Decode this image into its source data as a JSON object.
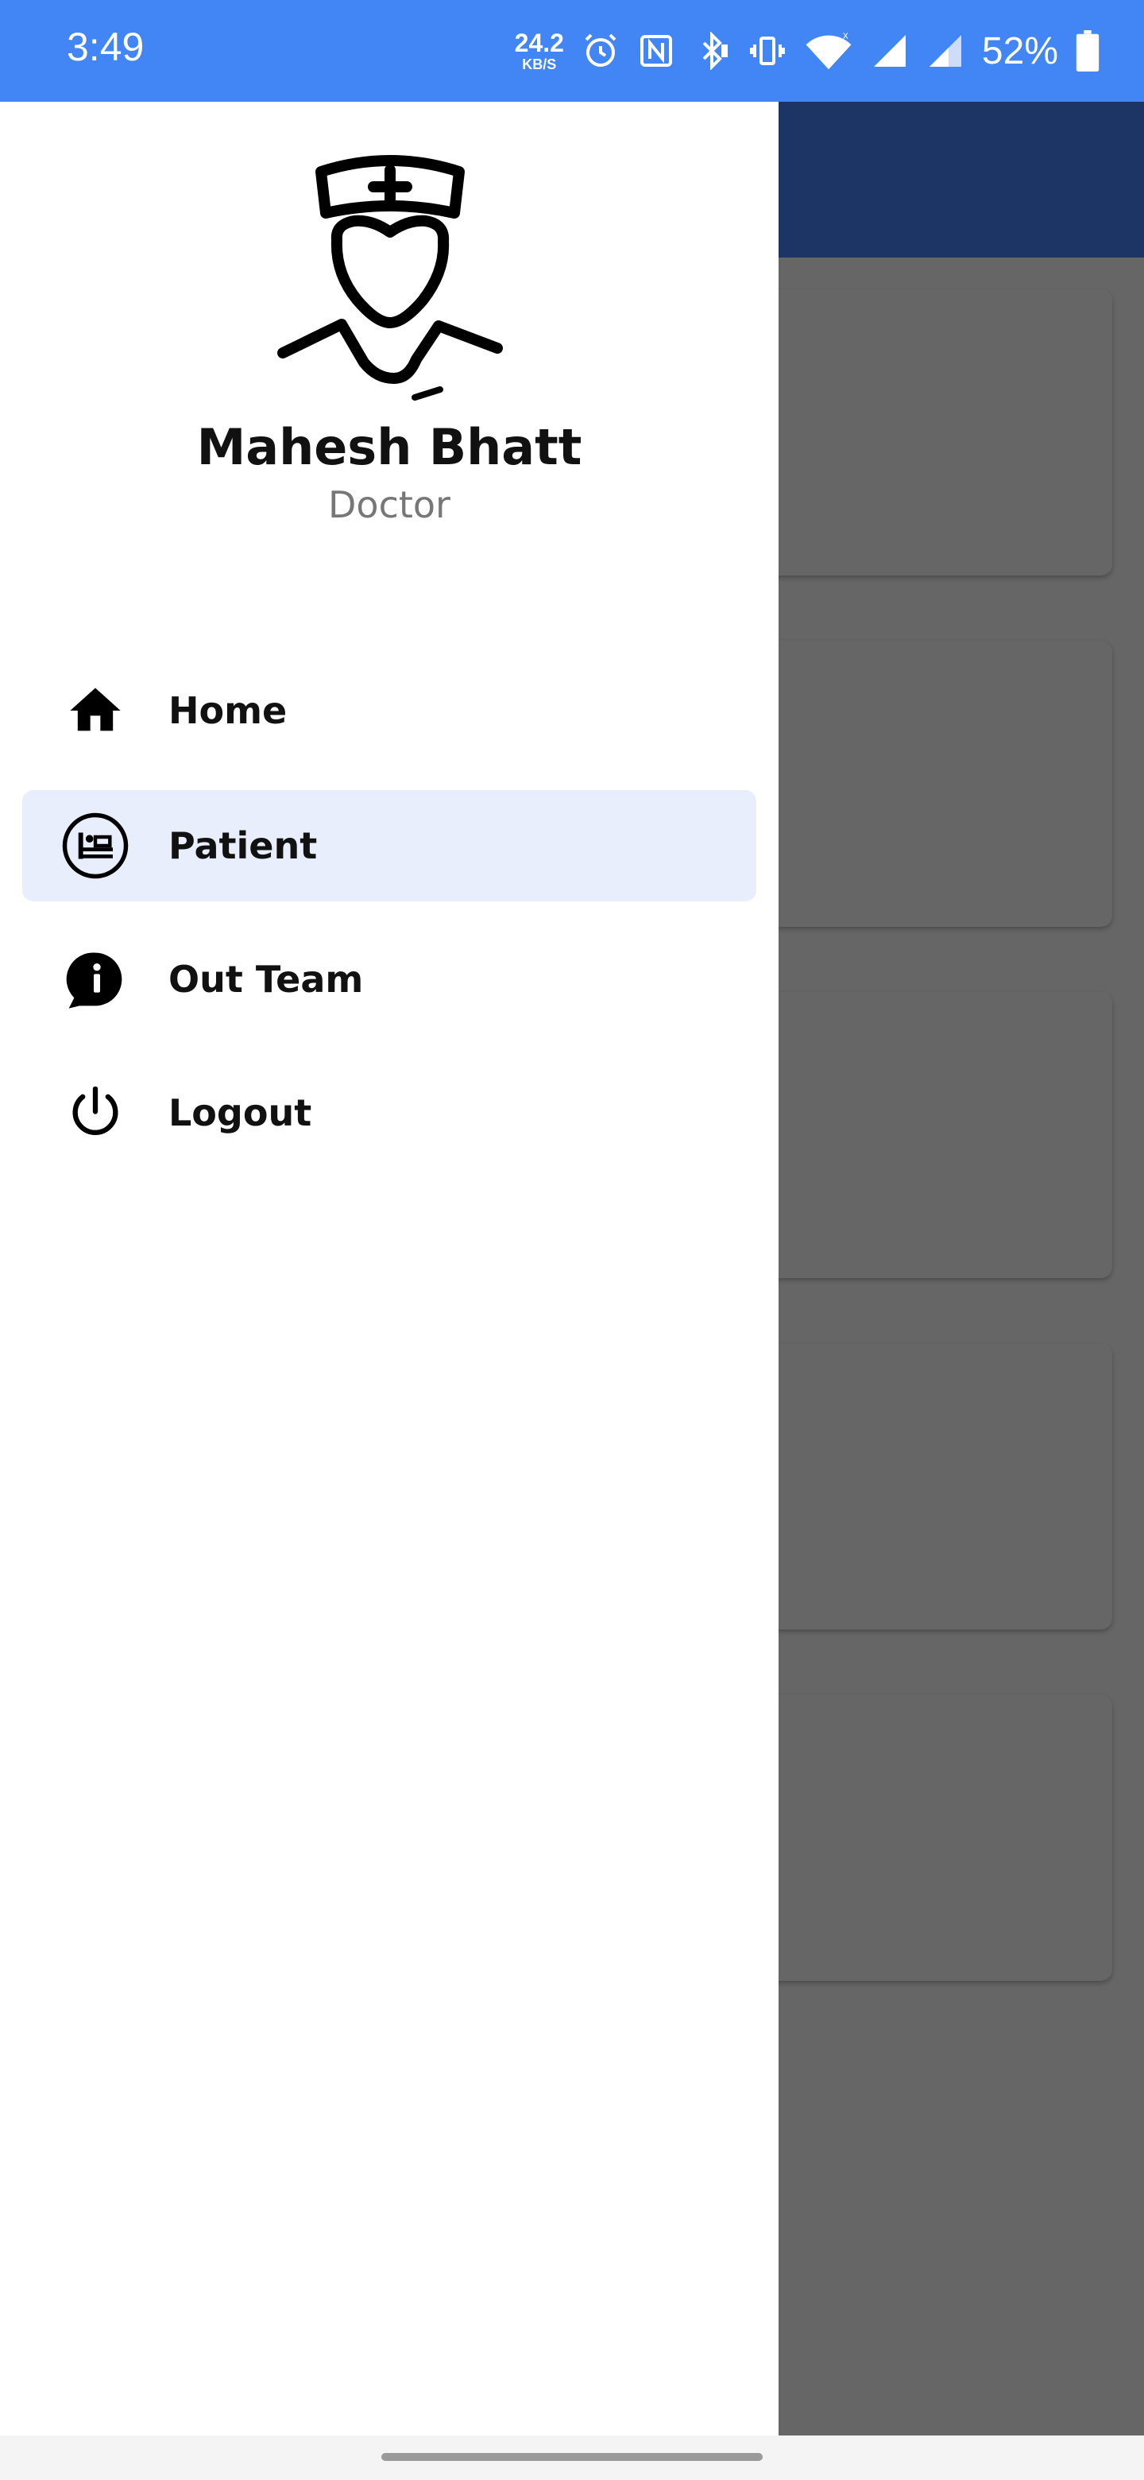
{
  "status_bar": {
    "time": "3:49",
    "net_speed_value": "24.2",
    "net_speed_unit": "KB/S",
    "battery_percent": "52%",
    "icons": [
      "alarm-icon",
      "nfc-icon",
      "bluetooth-icon",
      "vibrate-icon",
      "wifi-icon",
      "signal-icon",
      "signal-icon-2",
      "battery-icon"
    ]
  },
  "profile": {
    "name": "Mahesh Bhatt",
    "role": "Doctor",
    "avatar_icon": "doctor-avatar-icon"
  },
  "menu": {
    "items": [
      {
        "label": "Home",
        "icon": "home-icon",
        "active": false
      },
      {
        "label": "Patient",
        "icon": "bed-icon",
        "active": true
      },
      {
        "label": "Out Team",
        "icon": "info-chat-icon",
        "active": false
      },
      {
        "label": "Logout",
        "icon": "power-icon",
        "active": false
      }
    ]
  },
  "colors": {
    "status_bar": "#4285f4",
    "toolbar": "#1c3564",
    "active_item_bg": "#e8eefc",
    "scrim": "#666666"
  }
}
